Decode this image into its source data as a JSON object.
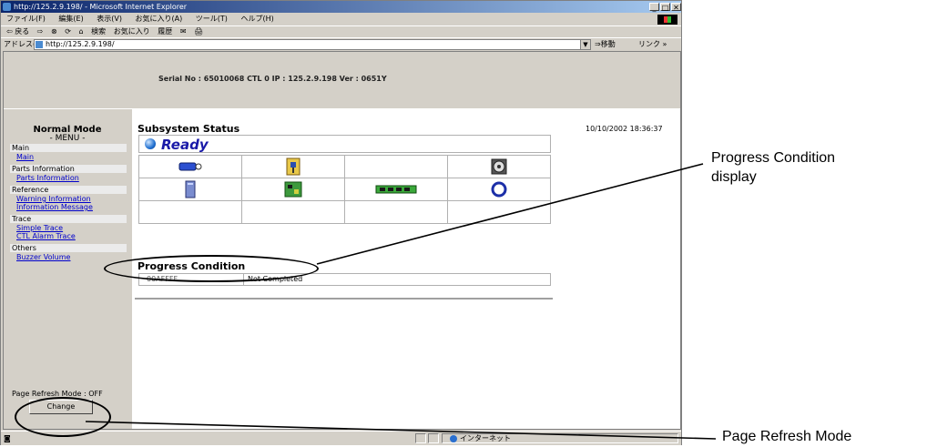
{
  "browser": {
    "title": "http://125.2.9.198/ - Microsoft Internet Explorer",
    "window_buttons": [
      "_",
      "□",
      "✕"
    ],
    "menus": [
      "ファイル(F)",
      "編集(E)",
      "表示(V)",
      "お気に入り(A)",
      "ツール(T)",
      "ヘルプ(H)"
    ],
    "toolbar": [
      "⇦ 戻る",
      "⇨",
      "⊗",
      "⟳",
      "⌂",
      "検索",
      "お気に入り",
      "履歴",
      "✉",
      "🖨"
    ],
    "address_label": "アドレス(D)",
    "address_value": "http://125.2.9.198/",
    "go_label": "移動",
    "links_label": "リンク »",
    "status_zone": "インターネット"
  },
  "header": {
    "serial_info": "Serial No : 65010068   CTL 0   IP : 125.2.9.198   Ver : 0651Y"
  },
  "sidebar": {
    "mode_title": "Normal Mode",
    "menu_label": "- MENU -",
    "sections": [
      {
        "label": "Main",
        "links": [
          "Main"
        ]
      },
      {
        "label": "Parts Information",
        "links": [
          "Parts Information"
        ]
      },
      {
        "label": "Reference",
        "links": [
          "Warning Information",
          "Information Message"
        ]
      },
      {
        "label": "Trace",
        "links": [
          "Simple Trace",
          "CTL Alarm Trace"
        ]
      },
      {
        "label": "Others",
        "links": [
          "Buzzer Volume"
        ]
      }
    ],
    "refresh_label": "Page Refresh Mode : OFF",
    "change_button": "Change"
  },
  "main": {
    "title": "Subsystem Status",
    "datetime": "10/10/2002 18:36:37",
    "status": "Ready",
    "component_icons": [
      [
        "battery-icon",
        "controller-icon",
        "",
        "fan-icon"
      ],
      [
        "disk-drive-icon",
        "circuit-board-icon",
        "memory-module-icon",
        "ring-status-icon"
      ],
      [
        "",
        "",
        "",
        ""
      ]
    ],
    "progress_title": "Progress Condition",
    "progress_rows": [
      {
        "code": "00AFFFF",
        "text": "Not Completed"
      }
    ]
  },
  "annotations": {
    "progress": "Progress Condition\ndisplay",
    "refresh": "Page Refresh Mode"
  }
}
